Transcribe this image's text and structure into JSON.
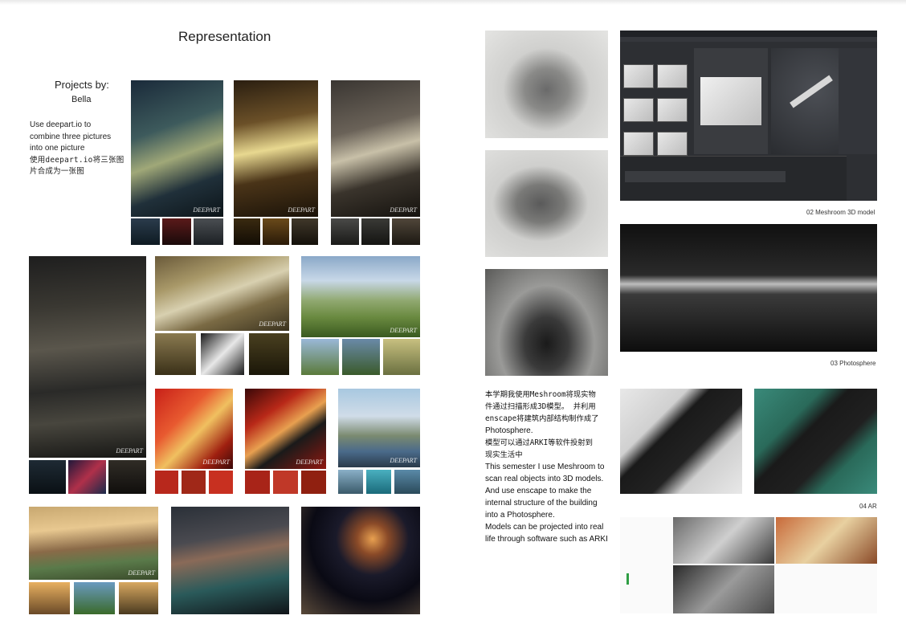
{
  "left_page": {
    "title": "Representation",
    "projects_by": "Projects by:",
    "author": "Bella",
    "desc_en_1": "Use deepart.io to",
    "desc_en_2": "combine three pictures",
    "desc_en_3": "into one picture",
    "desc_cn_1": "使用deepart.io将三张图",
    "desc_cn_2": "片合成为一张图",
    "watermark": "DEEPART"
  },
  "right_page": {
    "caption_meshroom": "02 Meshroom 3D model",
    "caption_photosphere": "03 Photosphere",
    "caption_ar": "04 AR",
    "body_lines": [
      "本学期我使用Meshroom将现实物",
      "件通过扫描形成3D模型。 并利用",
      "enscape将建筑内部结构制作成了",
      "Photosphere.",
      "模型可以通过ARKI等软件投射到",
      "现实生活中",
      "This semester I use Meshroom to",
      "scan real objects into 3D models.",
      "And use enscape to make the",
      "internal structure of the building",
      "into a Photosphere.",
      "Models can be projected into real",
      "life through software such as ARKI"
    ]
  },
  "colors": {
    "page_bg": "#ffffff",
    "text": "#222222",
    "meshroom_bg": "#2d2f33",
    "meshroom_accent": "#2f9e44"
  }
}
